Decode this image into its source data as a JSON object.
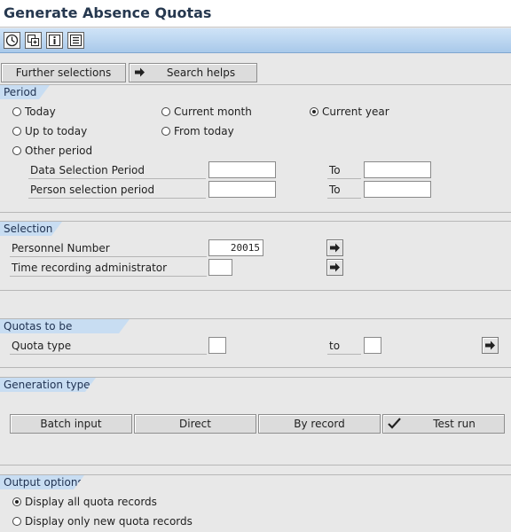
{
  "title": "Generate Absence Quotas",
  "toolbar": {
    "icons": [
      "execute-icon",
      "get-variant-icon",
      "info-icon",
      "selection-options-icon"
    ]
  },
  "buttons": {
    "further_selections": "Further selections",
    "search_helps": "Search helps"
  },
  "period": {
    "heading": "Period",
    "today": "Today",
    "current_month": "Current month",
    "current_year": "Current year",
    "up_to_today": "Up to today",
    "from_today": "From today",
    "other_period": "Other period",
    "selected": "current_year",
    "data_selection_label": "Data Selection Period",
    "person_selection_label": "Person selection period",
    "to_label_1": "To",
    "to_label_2": "To",
    "data_selection_from": "",
    "data_selection_to": "",
    "person_selection_from": "",
    "person_selection_to": ""
  },
  "selection": {
    "heading": "Selection",
    "personnel_number_label": "Personnel Number",
    "personnel_number_value": "20015",
    "time_admin_label": "Time recording administrator",
    "time_admin_value": ""
  },
  "quotas": {
    "heading": "Quotas to be generated",
    "quota_type_label": "Quota type",
    "to_label": "to",
    "quota_from": "",
    "quota_to": ""
  },
  "generation": {
    "heading": "Generation type",
    "batch_input": "Batch input",
    "direct": "Direct",
    "by_record": "By record",
    "test_run": "Test run"
  },
  "output": {
    "heading": "Output options",
    "display_all": "Display all quota records",
    "display_new": "Display only new quota records",
    "selected": "display_all"
  }
}
